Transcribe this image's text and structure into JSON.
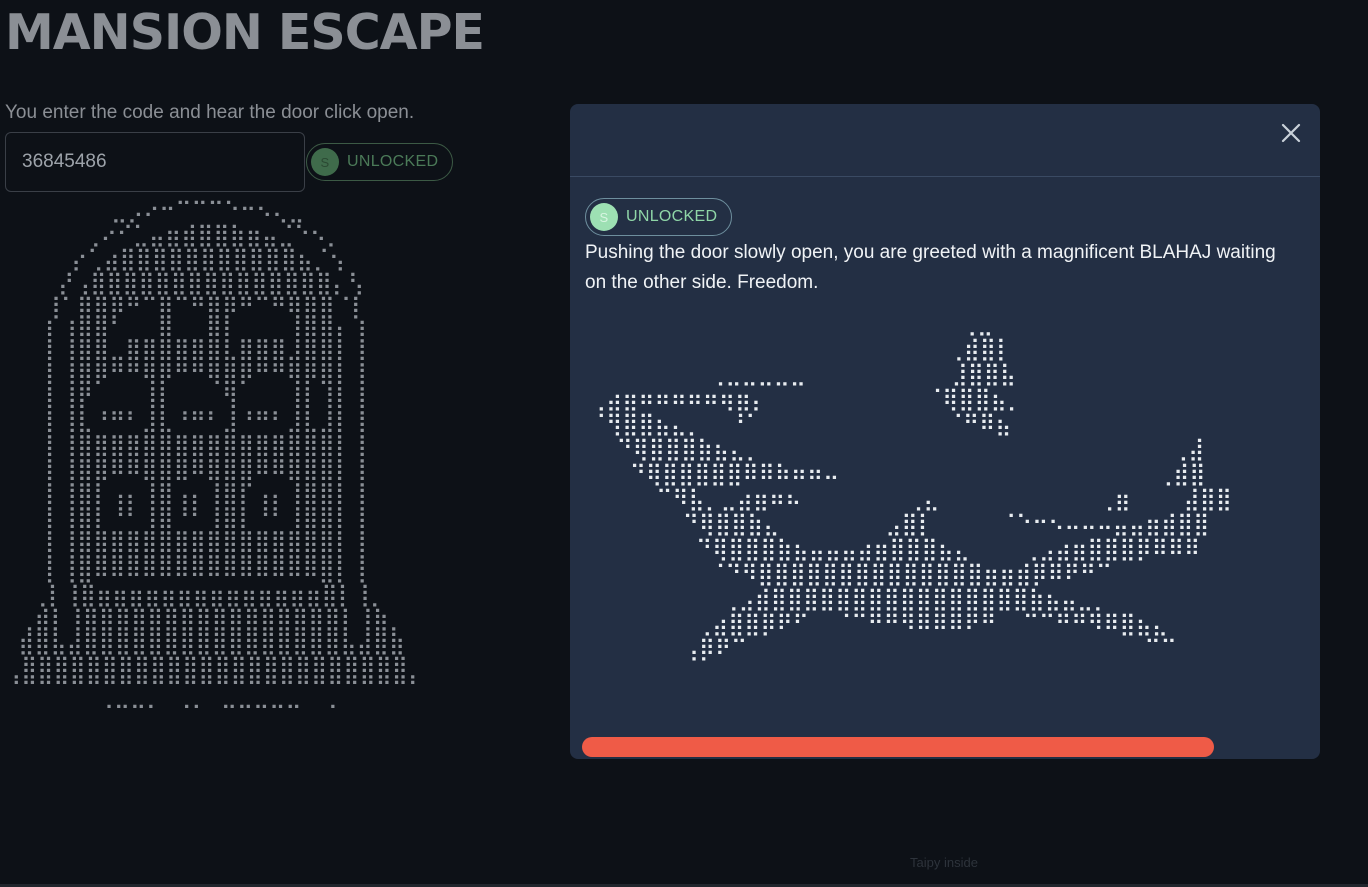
{
  "app": {
    "title": "MANSION ESCAPE"
  },
  "game": {
    "prompt": "You enter the code and hear the door click open.",
    "code_value": "36845486",
    "status_badge": {
      "icon_letter": "S",
      "label": "UNLOCKED"
    },
    "footer_note": "Taipy inside"
  },
  "modal": {
    "close_icon": "close-icon",
    "status_badge": {
      "icon_letter": "S",
      "label": "UNLOCKED"
    },
    "message": "Pushing the door slowly open, you are greeted with a magnificent BLAHAJ waiting on the other side. Freedom.",
    "progress_percent": 87
  },
  "colors": {
    "background": "#0d1117",
    "modal_background": "#232f44",
    "progress_bar": "#ef5b47",
    "badge_text": "#8fd6a7"
  }
}
